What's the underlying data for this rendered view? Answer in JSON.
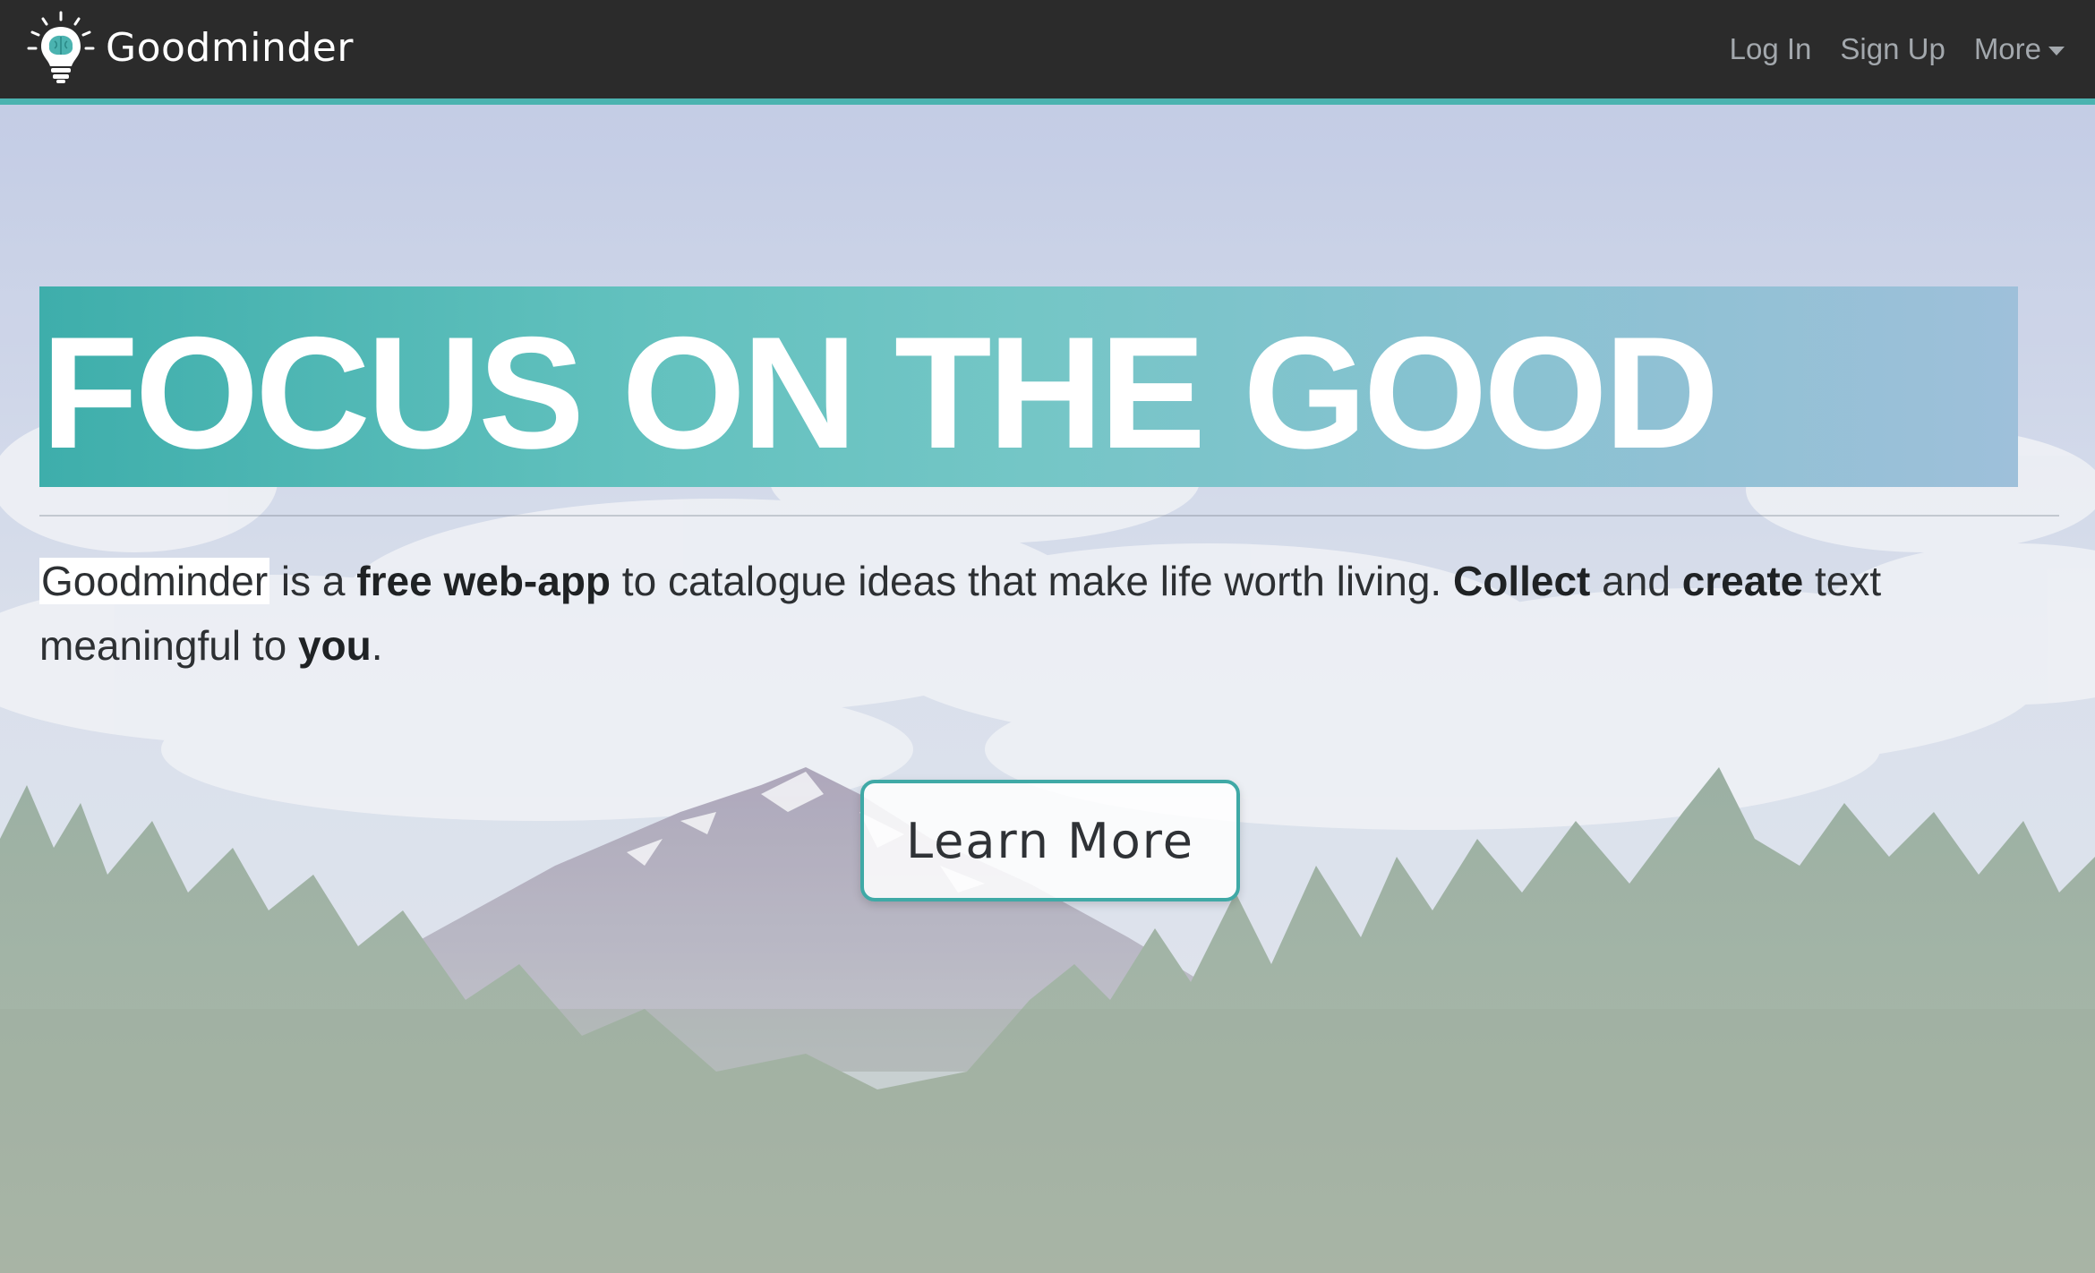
{
  "navbar": {
    "brand_name": "Goodminder",
    "links": {
      "login": "Log In",
      "signup": "Sign Up",
      "more": "More"
    }
  },
  "hero": {
    "headline": "FOCUS ON THE GOOD",
    "tagline": {
      "p1": "Goodminder",
      "p2": " is a ",
      "p3": "free web-app",
      "p4": " to catalogue ideas that make life worth living. ",
      "p5": "Collect",
      "p6": " and ",
      "p7": "create",
      "p8": " text meaningful to ",
      "p9": "you",
      "p10": "."
    },
    "button": "Learn More"
  },
  "colors": {
    "navbar_bg": "#2b2b2b",
    "accent": "#4bb3b0",
    "headline_band": "#5ebcb9"
  }
}
